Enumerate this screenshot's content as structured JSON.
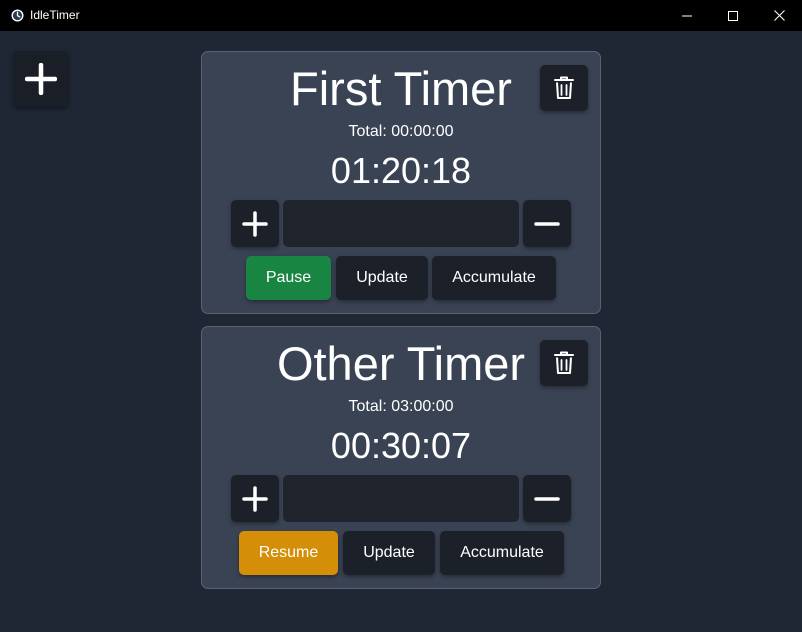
{
  "window": {
    "title": "IdleTimer"
  },
  "icons": {
    "app": "clock-icon",
    "minimize": "minimize-icon",
    "maximize": "maximize-icon",
    "close": "close-icon",
    "add": "plus-icon",
    "delete": "trash-icon",
    "increment": "plus-icon",
    "decrement": "minus-icon"
  },
  "colors": {
    "background": "#1f2735",
    "card": "#3a4354",
    "button": "#1c2129",
    "pause": "#198542",
    "resume": "#d48e07"
  },
  "timers": [
    {
      "name": "First Timer",
      "total": "Total: 00:00:00",
      "clock": "01:20:18",
      "amount_value": "",
      "toggle_label": "Pause",
      "update_label": "Update",
      "accumulate_label": "Accumulate"
    },
    {
      "name": "Other Timer",
      "total": "Total: 03:00:00",
      "clock": "00:30:07",
      "amount_value": "",
      "toggle_label": "Resume",
      "update_label": "Update",
      "accumulate_label": "Accumulate"
    }
  ]
}
